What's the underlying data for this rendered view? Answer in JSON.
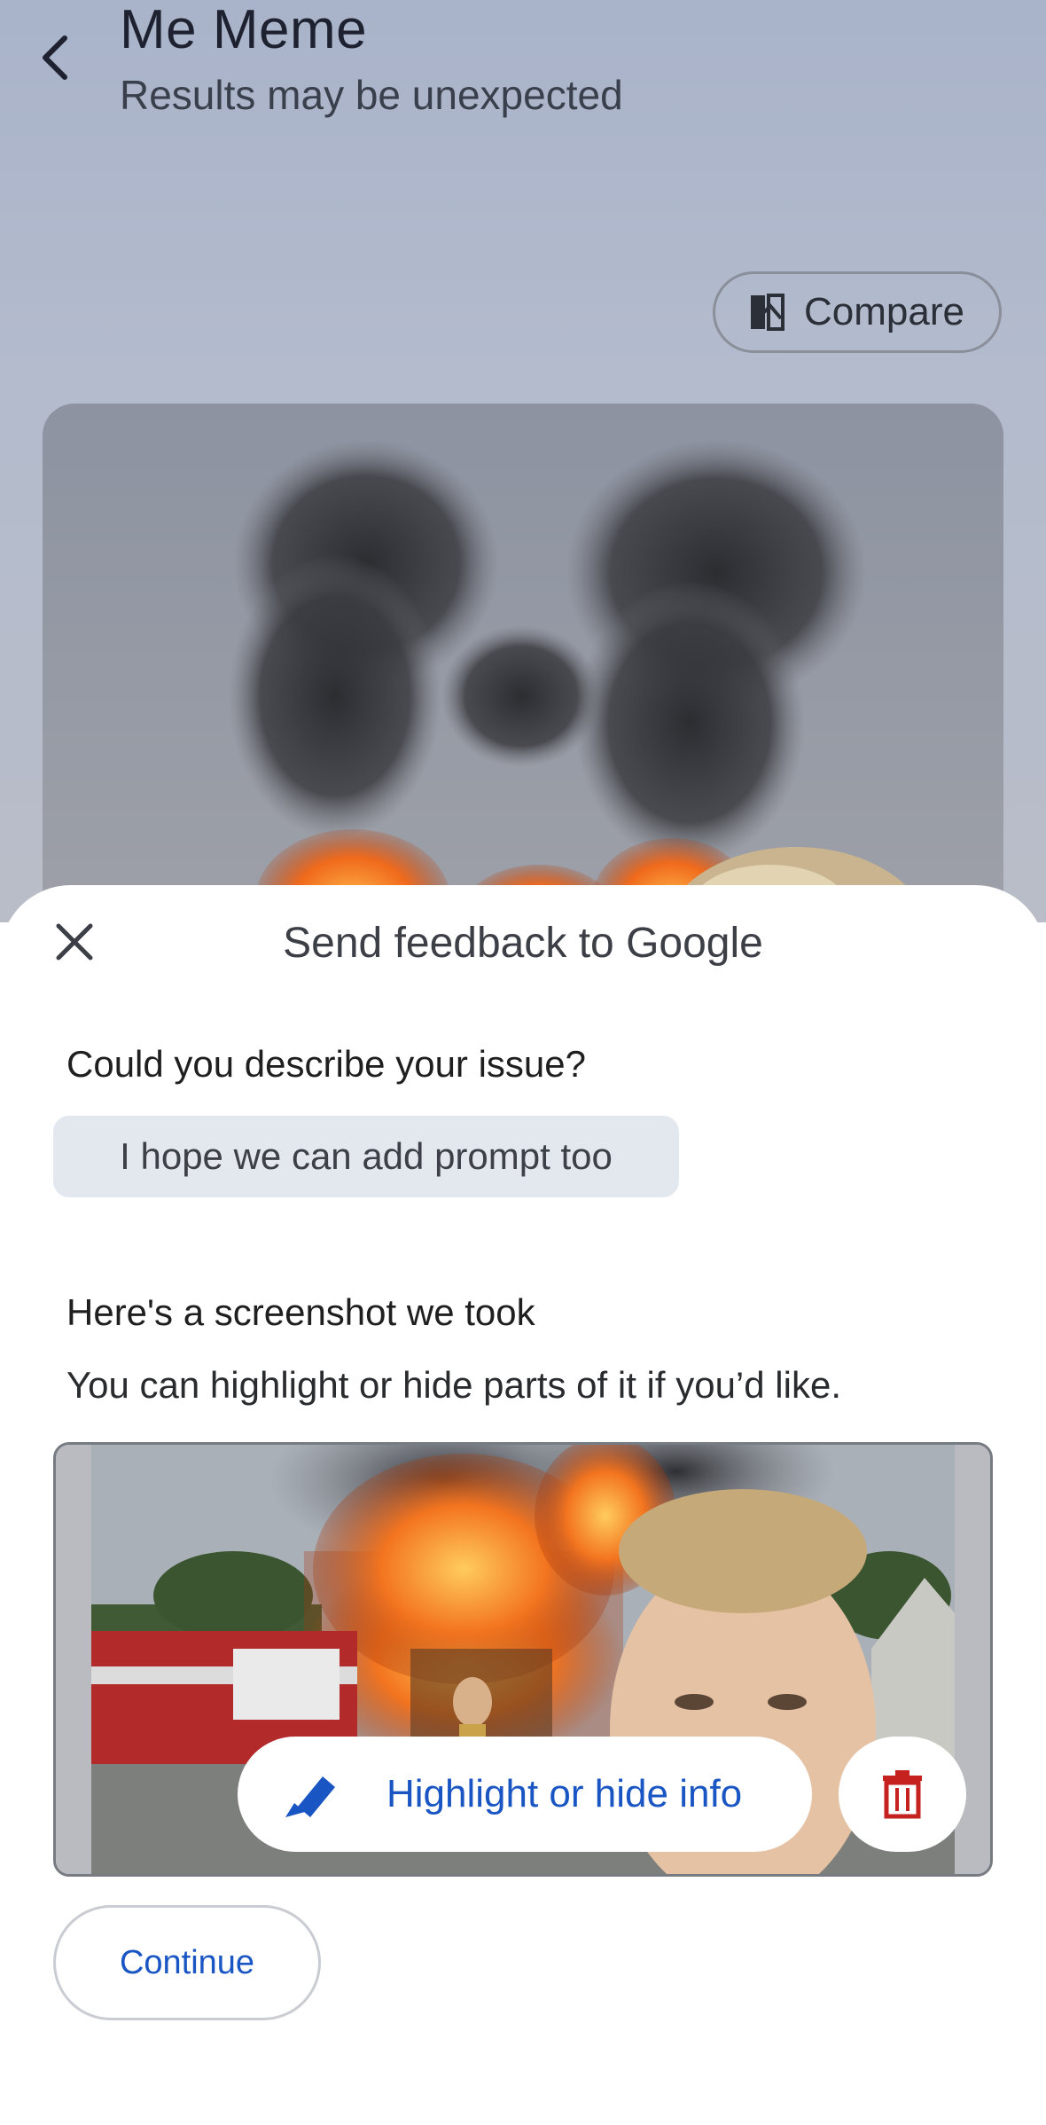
{
  "app": {
    "title": "Me Meme",
    "subtitle": "Results may be unexpected",
    "compare_label": "Compare",
    "back_icon": "chevron-left-icon",
    "compare_icon": "compare-icon"
  },
  "sheet": {
    "title": "Send feedback to Google",
    "close_icon": "close-icon",
    "question_label": "Could you describe your issue?",
    "answer_text": "I hope we can add prompt too",
    "screenshot_label": "Here's a screenshot we took",
    "screenshot_desc": "You can highlight or hide parts of it if you’d like.",
    "highlight_label": "Highlight or hide info",
    "highlight_icon": "pencil-icon",
    "delete_icon": "trash-icon",
    "continue_label": "Continue"
  },
  "colors": {
    "accent": "#1a55c4",
    "delete": "#c5221f",
    "chip_bg": "#e3e8ef"
  }
}
